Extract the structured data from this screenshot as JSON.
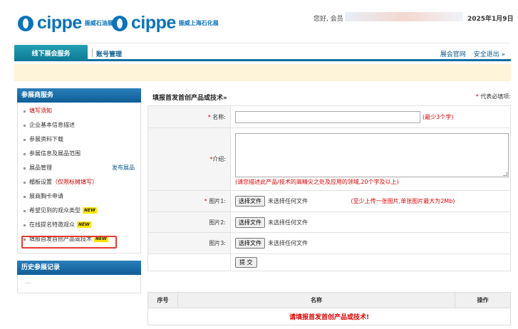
{
  "header": {
    "logo1_word": "cippe",
    "logo1_sub": "振威石油展",
    "logo2_word": "cippe",
    "logo2_sub": "振威上海石化展",
    "greeting": "您好, 会员",
    "date": "2025年1月9日"
  },
  "nav": {
    "active_tab": "线下展会服务",
    "account_tab": "账号管理",
    "official_site": "展会官网",
    "logout": "安全退出 »"
  },
  "sidebar": {
    "section_title": "参展商服务",
    "items": [
      {
        "label": "填写须知"
      },
      {
        "label": "企业基本信息描述"
      },
      {
        "label": "参展资料下载"
      },
      {
        "label": "参展信息及展品范围"
      },
      {
        "label": "展品管理",
        "right_link": "发布展品"
      },
      {
        "label": "楣板设置",
        "extra": "（仅限标摊填写）"
      },
      {
        "label": "展商胸卡申请"
      },
      {
        "label": "希望见到的观众类型",
        "badge": "NEW"
      },
      {
        "label": "在线提名特邀观众",
        "badge": "NEW"
      },
      {
        "label": "填报首发首创产品或技术",
        "badge": "NEW"
      }
    ],
    "history_title": "历史参展记录",
    "history_placeholder": "..."
  },
  "form": {
    "title": "填报首发首创产品或技术»",
    "required_note": "代表必填项:",
    "name_label": "名称:",
    "name_hint": "(最少3个字)",
    "intro_label": "介绍:",
    "intro_hint": "(请您描述此产品/技术的高精尖之处及应用的领域,20个字及以上)",
    "image1_label": "图片1:",
    "image2_label": "图片2:",
    "image3_label": "图片3:",
    "file_button": "选择文件",
    "no_file": "未选择任何文件",
    "image_hint": "(至少上传一张图片,单张图片最大为2Mb)",
    "submit": "提 交"
  },
  "list": {
    "columns": [
      "序号",
      "名称",
      "操作"
    ],
    "empty_message": "请填报首发首创产品或技术!"
  },
  "colors": {
    "brand_blue": "#0a73b8",
    "nav_teal": "#0d7b97",
    "required_red": "#d00000",
    "notice_bg": "#fdf4d9",
    "highlight_red": "#e53d2f"
  }
}
